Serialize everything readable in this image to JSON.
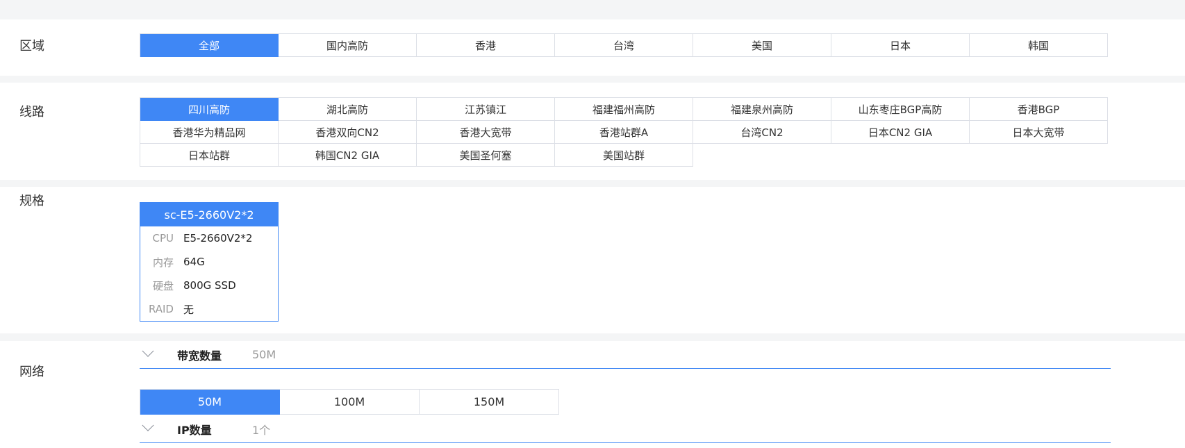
{
  "region": {
    "label": "区域",
    "options": [
      "全部",
      "国内高防",
      "香港",
      "台湾",
      "美国",
      "日本",
      "韩国"
    ],
    "selected": "全部"
  },
  "line": {
    "label": "线路",
    "options": [
      "四川高防",
      "湖北高防",
      "江苏镇江",
      "福建福州高防",
      "福建泉州高防",
      "山东枣庄BGP高防",
      "香港BGP",
      "香港华为精品网",
      "香港双向CN2",
      "香港大宽带",
      "香港站群A",
      "台湾CN2",
      "日本CN2 GIA",
      "日本大宽带",
      "日本站群",
      "韩国CN2 GIA",
      "美国圣何塞",
      "美国站群"
    ],
    "selected": "四川高防"
  },
  "spec": {
    "label": "规格",
    "card": {
      "title": "sc-E5-2660V2*2",
      "rows": [
        {
          "key": "CPU",
          "value": "E5-2660V2*2"
        },
        {
          "key": "内存",
          "value": "64G"
        },
        {
          "key": "硬盘",
          "value": "800G SSD"
        },
        {
          "key": "RAID",
          "value": "无"
        }
      ]
    }
  },
  "network": {
    "label": "网络",
    "bandwidth": {
      "title": "带宽数量",
      "value": "50M",
      "options": [
        "50M",
        "100M",
        "150M"
      ],
      "selected": "50M"
    },
    "ip": {
      "title": "IP数量",
      "value": "1个"
    }
  },
  "colors": {
    "accent": "#3f87f5",
    "border": "#dcdfe6",
    "background": "#f4f5f6"
  }
}
